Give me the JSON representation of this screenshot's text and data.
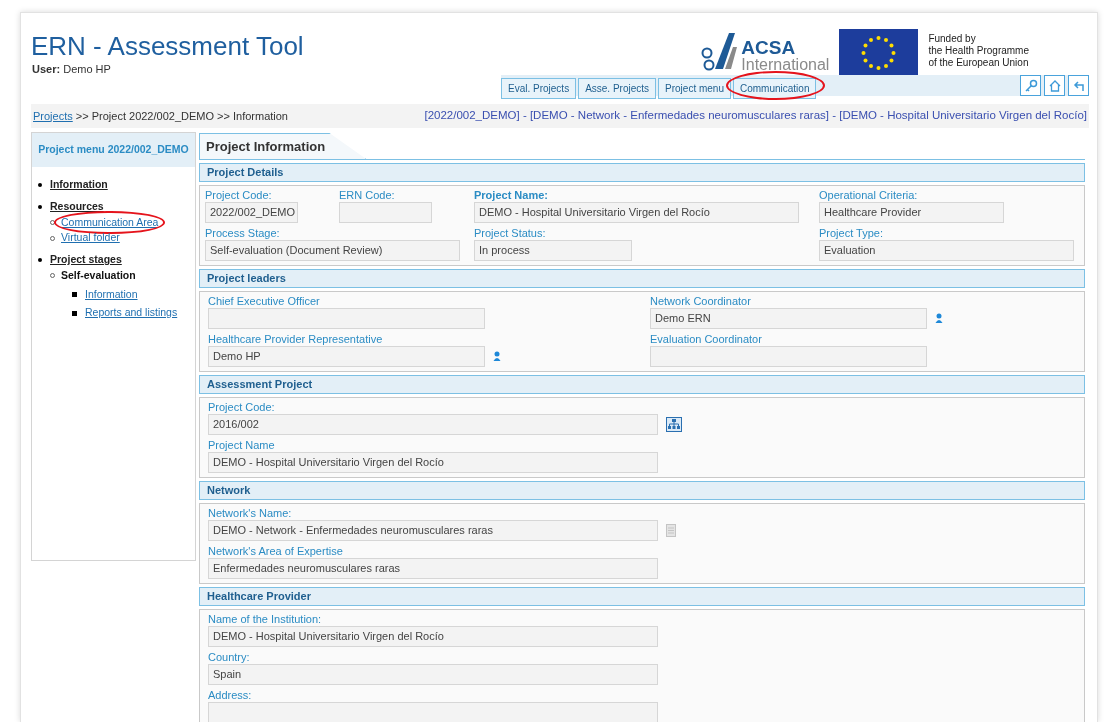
{
  "header": {
    "title": "ERN - Assessment Tool",
    "user_label": "User:",
    "user_name": "Demo HP",
    "partner_logo": {
      "name": "ACSA",
      "subtitle": "International"
    },
    "funding_text": [
      "Funded by",
      "the Health Programme",
      "of the European Union"
    ]
  },
  "nav_tabs": [
    {
      "label": "Eval. Projects",
      "highlighted": false
    },
    {
      "label": "Asse. Projects",
      "highlighted": false
    },
    {
      "label": "Project menu",
      "highlighted": false
    },
    {
      "label": "Communication",
      "highlighted": true
    }
  ],
  "breadcrumb": {
    "links": [
      "Projects"
    ],
    "rest": ">> Project 2022/002_DEMO >> Information",
    "context": "[2022/002_DEMO] - [DEMO - Network - Enfermedades neuromusculares raras] - [DEMO - Hospital Universitario Virgen del Rocío]"
  },
  "sidebar": {
    "title": "Project menu 2022/002_DEMO",
    "items": [
      {
        "label": "Information"
      },
      {
        "label": "Resources",
        "children": [
          {
            "label": "Communication Area",
            "link": true,
            "highlighted": true
          },
          {
            "label": "Virtual folder",
            "link": true,
            "highlighted": false
          }
        ]
      },
      {
        "label": "Project stages",
        "children": [
          {
            "label": "Self-evaluation",
            "link": false,
            "highlighted": false,
            "children": [
              {
                "label": "Information"
              },
              {
                "label": "Reports and listings"
              }
            ]
          }
        ]
      }
    ]
  },
  "page_tab": "Project Information",
  "sections": [
    {
      "title": "Project Details",
      "fields": [
        {
          "label": "Project Code:",
          "value": "2022/002_DEMO",
          "emphasized": false
        },
        {
          "label": "ERN Code:",
          "emphasized": false
        },
        {
          "label": "Project Name:",
          "value": "DEMO - Hospital Universitario Virgen del Rocío",
          "emphasized": true
        },
        {
          "label": "Operational Criteria:",
          "value": "Healthcare Provider",
          "emphasized": false
        },
        {
          "label": "Process Stage:",
          "value": "Self-evaluation (Document Review)",
          "emphasized": false
        },
        {
          "label": "Project Status:",
          "value": "In process",
          "emphasized": false
        },
        {
          "label": "Project Type:",
          "value": "Evaluation",
          "emphasized": false
        }
      ]
    },
    {
      "title": "Project leaders",
      "fields": [
        {
          "label": "Chief Executive Officer",
          "emphasized": false
        },
        {
          "label": "Network Coordinator",
          "value": "Demo ERN",
          "emphasized": false
        },
        {
          "label": "Healthcare Provider Representative",
          "value": "Demo HP",
          "emphasized": false
        },
        {
          "label": "Evaluation Coordinator",
          "emphasized": false
        }
      ]
    },
    {
      "title": "Assessment Project",
      "fields": [
        {
          "label": "Project Code:",
          "value": "2016/002",
          "emphasized": false
        },
        {
          "label": "Project Name",
          "value": "DEMO - Hospital Universitario Virgen del Rocío",
          "emphasized": false
        }
      ]
    },
    {
      "title": "Network",
      "fields": [
        {
          "label": "Network's Name:",
          "value": "DEMO - Network - Enfermedades neuromusculares raras",
          "emphasized": false
        },
        {
          "label": "Network's Area of Expertise",
          "value": "Enfermedades neuromusculares raras",
          "emphasized": false
        }
      ]
    },
    {
      "title": "Healthcare Provider",
      "fields": [
        {
          "label": "Name of the Institution:",
          "value": "DEMO - Hospital Universitario Virgen del Rocío",
          "emphasized": false
        },
        {
          "label": "Country:",
          "value": "Spain",
          "emphasized": false
        },
        {
          "label": "Address:",
          "emphasized": false
        }
      ]
    }
  ]
}
